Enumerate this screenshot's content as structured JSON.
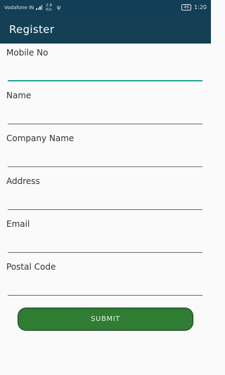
{
  "status_bar": {
    "carrier": "Vodafone IN",
    "net_speed_value": "2.8",
    "net_speed_unit": "K/s",
    "battery": "46",
    "time": "1:20"
  },
  "appbar": {
    "title": "Register"
  },
  "form": {
    "fields": [
      {
        "label": "Mobile No",
        "value": ""
      },
      {
        "label": "Name",
        "value": ""
      },
      {
        "label": "Company Name",
        "value": ""
      },
      {
        "label": "Address",
        "value": ""
      },
      {
        "label": "Email",
        "value": ""
      },
      {
        "label": "Postal Code",
        "value": ""
      }
    ],
    "submit_label": "SUBMIT",
    "active_color": "#26a69a",
    "button_color": "#2e7d32"
  }
}
